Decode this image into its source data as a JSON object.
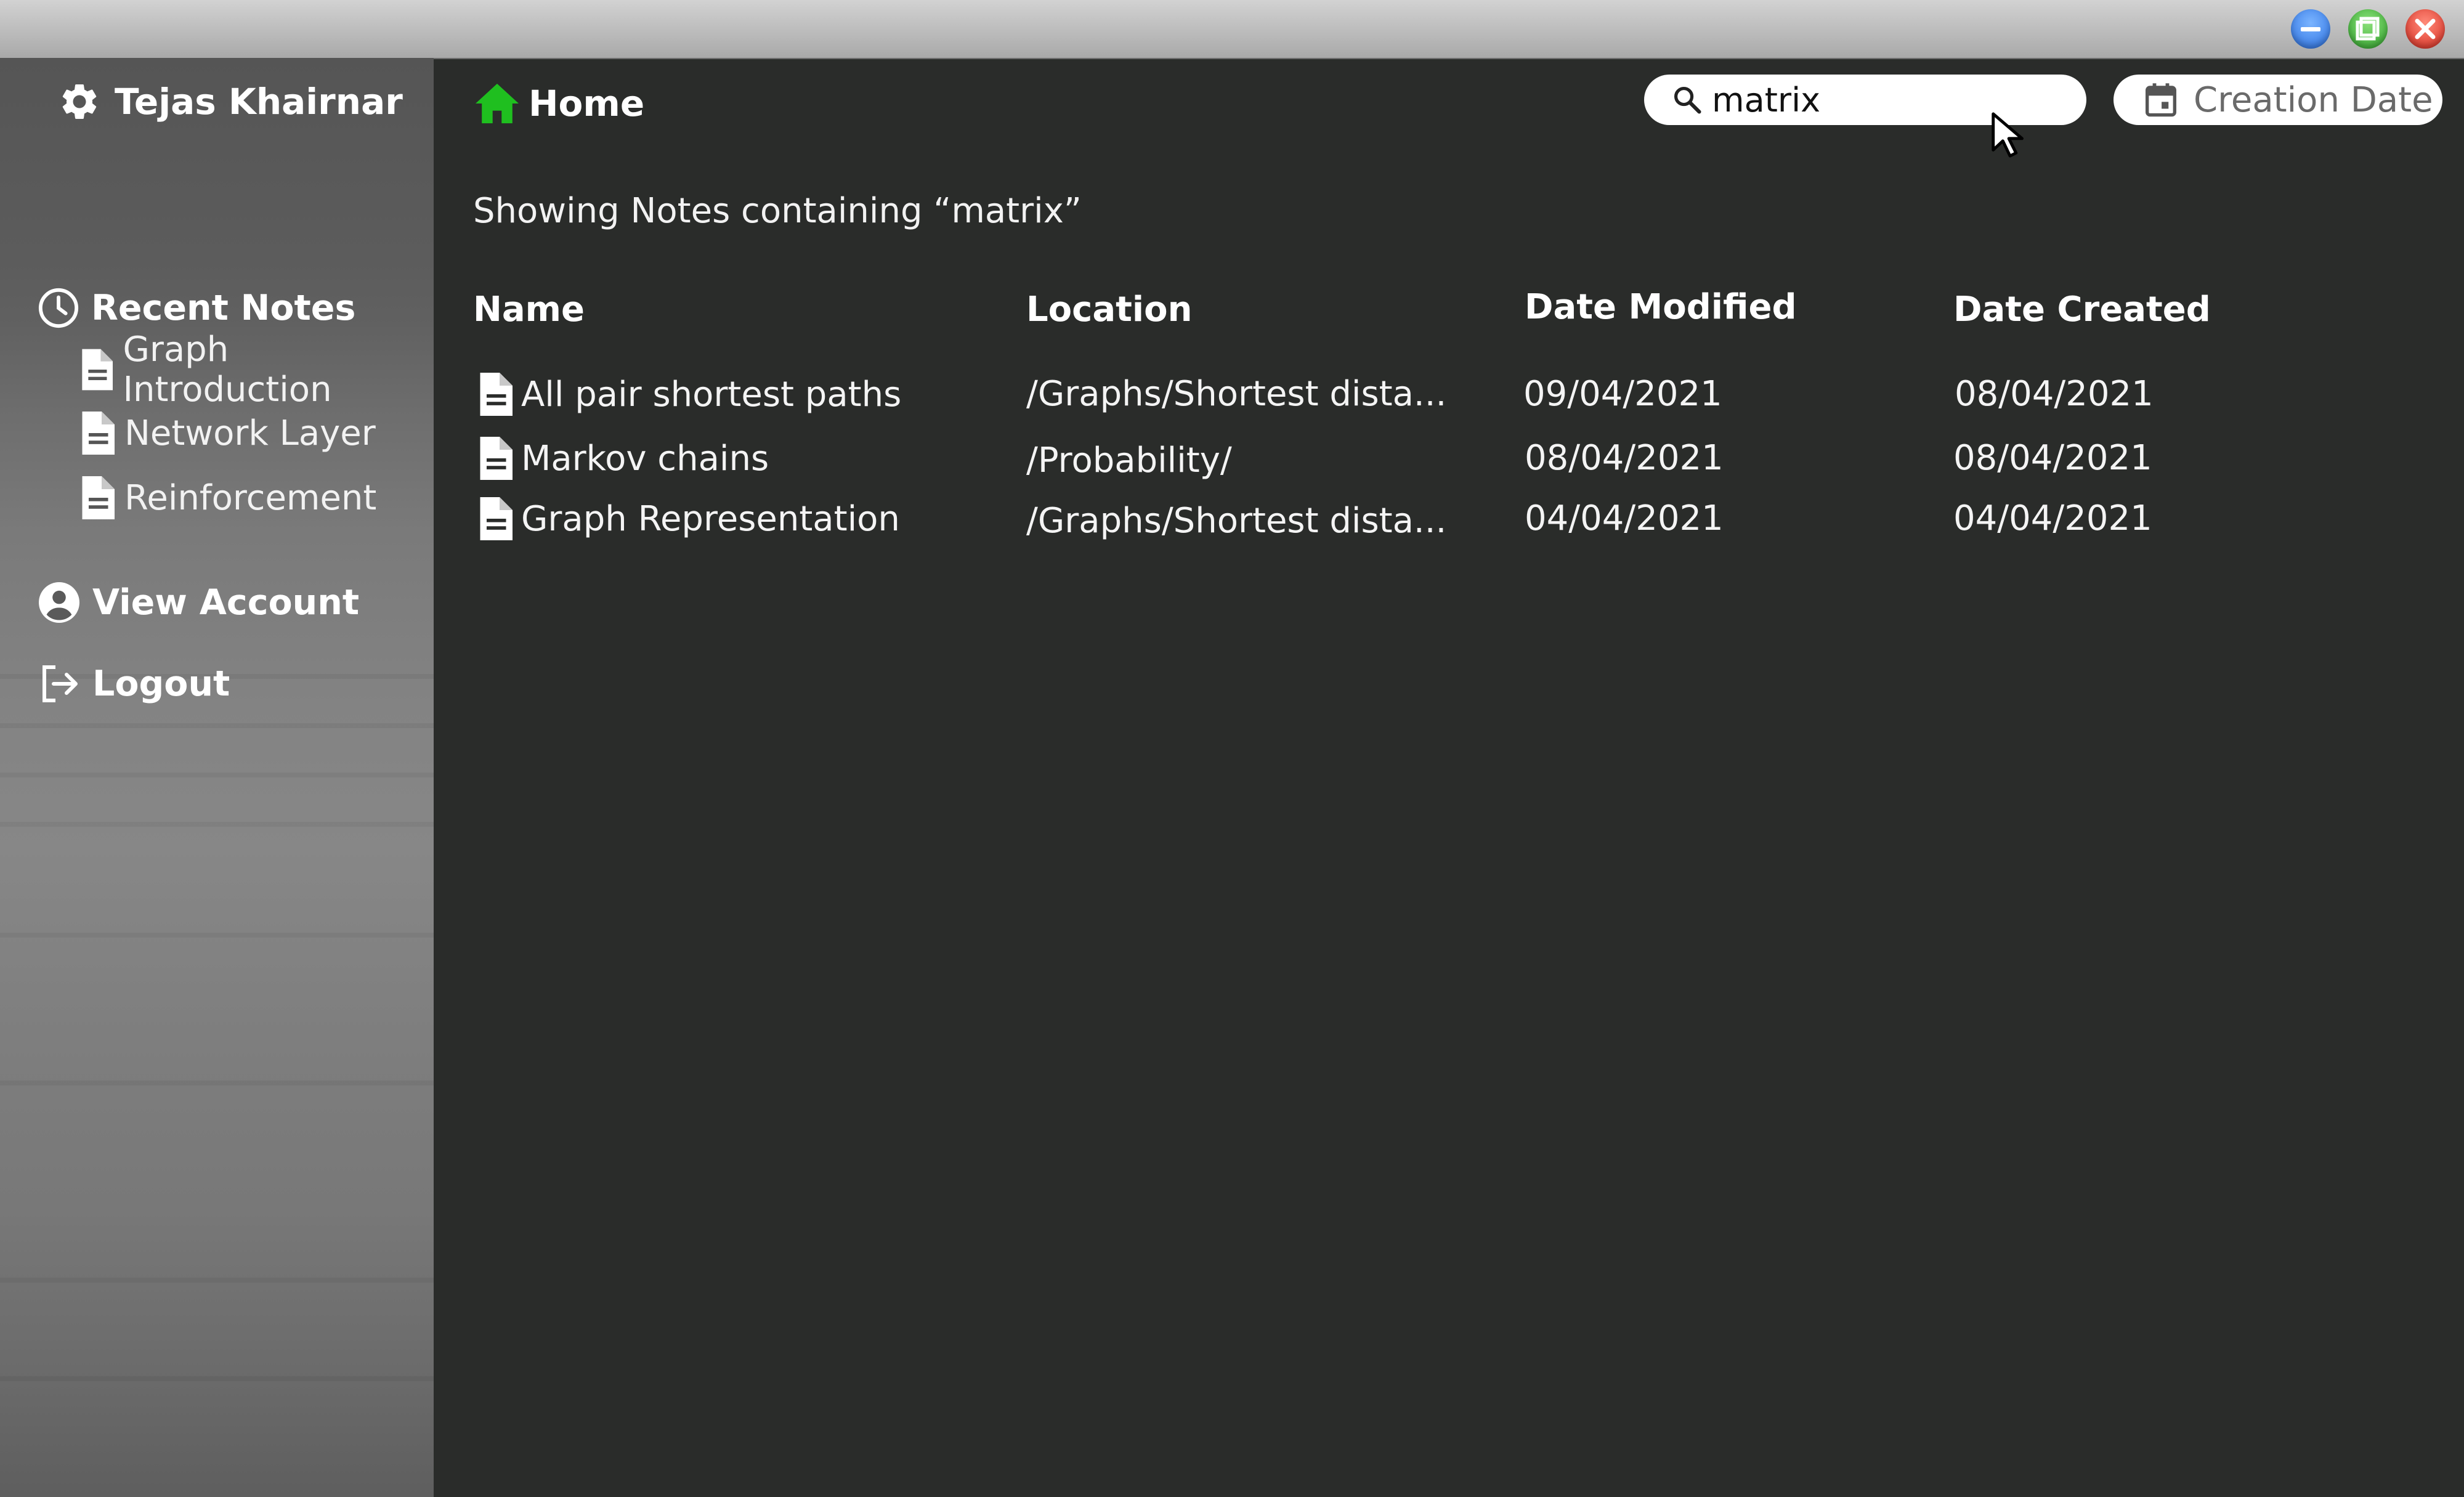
{
  "window": {
    "controls": [
      {
        "name": "minimize",
        "icon": "minimize-icon",
        "color": "#2a6fe0"
      },
      {
        "name": "maximize",
        "icon": "maximize-icon",
        "color": "#2ea32a"
      },
      {
        "name": "close",
        "icon": "close-icon",
        "color": "#d62a1e"
      }
    ]
  },
  "sidebar": {
    "user": {
      "name": "Tejas Khairnar",
      "icon": "gear-icon"
    },
    "recent": {
      "label": "Recent Notes",
      "icon": "clock-icon",
      "items": [
        {
          "label": "Graph Introduction",
          "icon": "document-icon"
        },
        {
          "label": "Network Layer",
          "icon": "document-icon"
        },
        {
          "label": "Reinforcement",
          "icon": "document-icon"
        }
      ]
    },
    "account": {
      "label": "View Account",
      "icon": "account-icon"
    },
    "logout": {
      "label": "Logout",
      "icon": "logout-icon"
    }
  },
  "header": {
    "home": {
      "label": "Home",
      "icon": "home-icon",
      "icon_color": "#1fbf1f"
    },
    "search": {
      "value": "matrix",
      "icon": "search-icon"
    },
    "date_filter": {
      "label": "Creation Date",
      "icon": "calendar-icon"
    }
  },
  "results": {
    "caption": "Showing Notes containing “matrix”",
    "columns": {
      "name": "Name",
      "location": "Location",
      "modified": "Date Modified",
      "created": "Date Created"
    },
    "rows": [
      {
        "name": "All pair shortest paths",
        "location": "/Graphs/Shortest dista...",
        "modified": "09/04/2021",
        "created": "08/04/2021"
      },
      {
        "name": "Markov chains",
        "location": "/Probability/",
        "modified": "08/04/2021",
        "created": "08/04/2021"
      },
      {
        "name": "Graph Representation",
        "location": "/Graphs/Shortest dista...",
        "modified": "04/04/2021",
        "created": "04/04/2021"
      }
    ]
  }
}
